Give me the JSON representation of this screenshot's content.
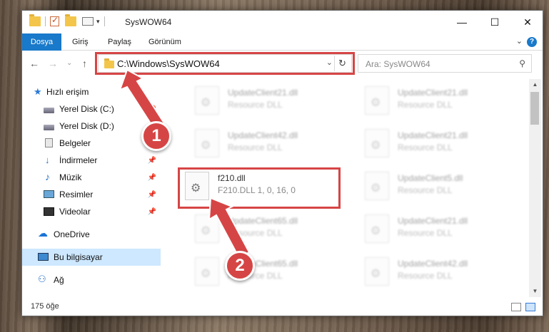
{
  "window": {
    "title": "SysWOW64",
    "minimize_glyph": "—",
    "maximize_glyph": "☐",
    "close_glyph": "✕"
  },
  "ribbon": {
    "tabs": [
      {
        "label": "Dosya"
      },
      {
        "label": "Giriş"
      },
      {
        "label": "Paylaş"
      },
      {
        "label": "Görünüm"
      }
    ],
    "help": "?",
    "expand": "⌄"
  },
  "nav": {
    "back": "←",
    "forward": "→",
    "recent": "⌄",
    "up": "↑",
    "address": "C:\\Windows\\SysWOW64",
    "address_dropdown": "⌄",
    "refresh": "↻",
    "search_placeholder": "Ara: SysWOW64",
    "search_glyph": "⚲"
  },
  "sidebar": {
    "items": [
      {
        "label": "Hızlı erişim",
        "icon": "star-icon",
        "glyph": "★"
      },
      {
        "label": "Yerel Disk (C:)",
        "icon": "drive-icon",
        "pinned": true
      },
      {
        "label": "Yerel Disk (D:)",
        "icon": "drive-icon",
        "pinned": true
      },
      {
        "label": "Belgeler",
        "icon": "document-icon",
        "pinned": true
      },
      {
        "label": "İndirmeler",
        "icon": "download-icon",
        "glyph": "↓",
        "pinned": true
      },
      {
        "label": "Müzik",
        "icon": "music-icon",
        "glyph": "♪",
        "pinned": true
      },
      {
        "label": "Resimler",
        "icon": "pictures-icon",
        "pinned": true
      },
      {
        "label": "Videolar",
        "icon": "video-icon",
        "pinned": true
      },
      {
        "label": "OneDrive",
        "icon": "cloud-icon",
        "glyph": "☁"
      },
      {
        "label": "Bu bilgisayar",
        "icon": "computer-icon",
        "selected": true
      },
      {
        "label": "Ağ",
        "icon": "network-icon",
        "glyph": "⚇"
      }
    ],
    "pin_glyph": "📌"
  },
  "files": {
    "left": [
      {
        "name": "UpdateClient21.dll",
        "desc": "Resource DLL"
      },
      {
        "name": "UpdateClient42.dll",
        "desc": "Resource DLL"
      },
      {
        "name": "f210.dll",
        "desc": "F210.DLL 1, 0, 16, 0"
      },
      {
        "name": "UpdateClient65.dll",
        "desc": "Resource DLL"
      },
      {
        "name": "UpdateClient65.dll",
        "desc": "Resource DLL"
      }
    ],
    "right": [
      {
        "name": "UpdateClient21.dll",
        "desc": "Resource DLL"
      },
      {
        "name": "UpdateClient21.dll",
        "desc": "Resource DLL"
      },
      {
        "name": "UpdateClient5.dll",
        "desc": "Resource DLL"
      },
      {
        "name": "UpdateClient21.dll",
        "desc": "Resource DLL"
      },
      {
        "name": "UpdateClient42.dll",
        "desc": "Resource DLL"
      }
    ]
  },
  "status": {
    "count": "175 öğe"
  },
  "annotations": {
    "step1": "1",
    "step2": "2",
    "color": "#d64545"
  }
}
